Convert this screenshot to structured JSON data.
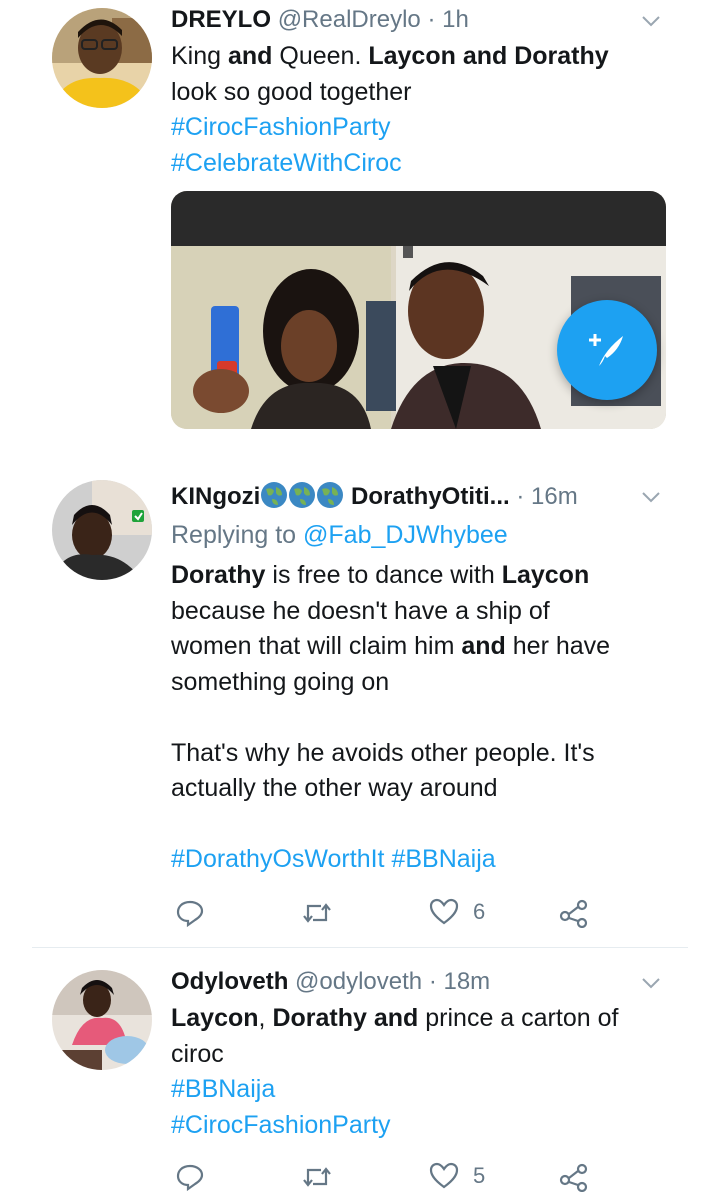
{
  "tweets": [
    {
      "name": "DREYLO",
      "handle": "@RealDreylo",
      "dot": "·",
      "time": "1h",
      "text_line1_a": "King ",
      "text_line1_b": "and",
      "text_line1_c": " Queen. ",
      "text_line1_d": "Laycon and Dorathy",
      "text_line2": "look so good together",
      "hashtags": [
        "#CirocFashionParty",
        "#CelebrateWithCiroc"
      ],
      "has_media": true
    },
    {
      "name": "KINgozi",
      "name_suffix": "DorathyOtiti...",
      "dot": "·",
      "time": "16m",
      "replying_prefix": "Replying to ",
      "replying_to": "@Fab_DJWhybee",
      "p1_l1_a": "Dorathy",
      "p1_l1_b": " is free to dance with ",
      "p1_l1_c": "Laycon",
      "p1_l2": "because he doesn't have a ship of",
      "p1_l3_a": "women that will claim him ",
      "p1_l3_b": "and",
      "p1_l3_c": " her have",
      "p1_l4": "something going on",
      "p2_l1": "That's why he avoids other people. It's",
      "p2_l2": "actually the other way around",
      "hashtags_line": [
        "#DorathyOsWorthIt",
        "#BBNaija"
      ],
      "like_count": "6"
    },
    {
      "name": "Odyloveth",
      "handle": "@odyloveth",
      "dot": "·",
      "time": "18m",
      "l1_a": "Laycon",
      "l1_b": ", ",
      "l1_c": "Dorathy",
      "l1_d": " ",
      "l1_e": "and",
      "l1_f": " prince a carton of",
      "l2": "ciroc",
      "hashtags": [
        "#BBNaija",
        "#CirocFashionParty"
      ],
      "like_count": "5"
    }
  ],
  "colors": {
    "link": "#1da1f2",
    "muted": "#657786",
    "text": "#14171a",
    "fab": "#1da1f2"
  },
  "icons": [
    "chevron-down-icon",
    "reply-icon",
    "retweet-icon",
    "like-icon",
    "share-icon",
    "compose-tweet-icon",
    "globe-emoji-icon"
  ]
}
